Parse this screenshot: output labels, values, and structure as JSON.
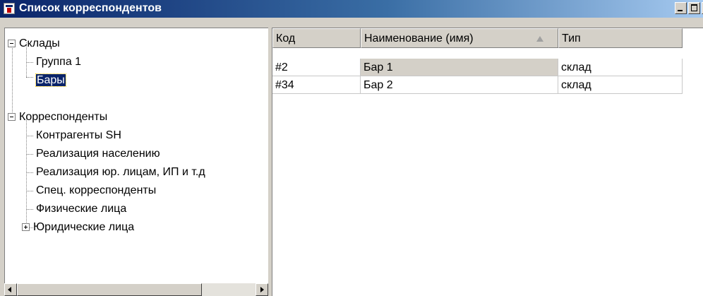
{
  "window": {
    "title": "Список корреспондентов",
    "icon": "app-icon",
    "buttons": {
      "minimize": "minimize-icon",
      "maximize": "maximize-icon",
      "close": "close-icon"
    }
  },
  "tree": {
    "nodes": [
      {
        "label": "Склады",
        "expander": "minus"
      },
      {
        "label": "Группа 1"
      },
      {
        "label": "Бары",
        "selected": true
      },
      {
        "label": "Корреспонденты",
        "expander": "minus"
      },
      {
        "label": "Контрагенты SH"
      },
      {
        "label": "Реализация населению"
      },
      {
        "label": "Реализация юр. лицам, ИП и т.д"
      },
      {
        "label": "Спец. корреспонденты"
      },
      {
        "label": "Физические лица"
      },
      {
        "label": "Юридические лица",
        "expander": "plus"
      }
    ]
  },
  "grid": {
    "columns": [
      "Код",
      "Наименование (имя)",
      "Тип"
    ],
    "sort_column": "Наименование (имя)",
    "rows": [
      {
        "code": "#2",
        "name": "Бар 1",
        "type": "склад"
      },
      {
        "code": "#34",
        "name": "Бар 2",
        "type": "склад"
      }
    ]
  },
  "colors": {
    "titlebar_start": "#0a246a",
    "titlebar_end": "#a6caf0",
    "selection": "#0a246a",
    "face": "#d4d0c8"
  }
}
